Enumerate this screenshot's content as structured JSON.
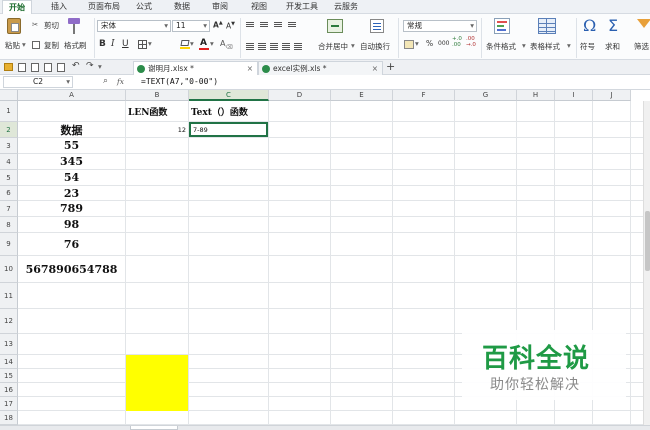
{
  "menu": {
    "items": [
      "开始",
      "插入",
      "页面布局",
      "公式",
      "数据",
      "审阅",
      "视图",
      "开发工具",
      "云服务"
    ],
    "active_index": 0
  },
  "ribbon": {
    "paste": "粘贴",
    "cut": "剪切",
    "copy": "复制",
    "format_painter": "格式刷",
    "font_name": "宋体",
    "font_size": "11",
    "merge_center": "合并居中",
    "wrap_text": "自动换行",
    "number_format": "常规",
    "conditional_format": "条件格式",
    "table_style": "表格样式",
    "symbol": "符号",
    "sum": "求和",
    "filter": "筛选",
    "percent": "%",
    "comma": "000"
  },
  "tabs": [
    {
      "label": "谢明月.xlsx *",
      "active": true
    },
    {
      "label": "excel实例.xls *",
      "active": false
    }
  ],
  "formula_bar": {
    "cell_ref": "C2",
    "fx": "fx",
    "formula": "=TEXT(A7,\"0-00\")"
  },
  "sheet": {
    "columns": [
      "A",
      "B",
      "C",
      "D",
      "E",
      "F",
      "G",
      "H",
      "I",
      "J"
    ],
    "active_column": "C",
    "rows": [
      "1",
      "2",
      "3",
      "4",
      "5",
      "6",
      "7",
      "8",
      "9",
      "10",
      "11",
      "12",
      "13",
      "14",
      "15",
      "16",
      "17",
      "18"
    ],
    "active_row": "2",
    "cells": {
      "B1": "LEN函数",
      "C1": "Text（）函数",
      "A2": "数据",
      "B2": "12",
      "C2": "7-89",
      "A3": "55",
      "A4": "345",
      "A5": "54",
      "A6": "23",
      "A7": "789",
      "A8": "98",
      "A9": "76",
      "A10": "567890654788"
    },
    "highlight_color": "#ffff00",
    "active_border_color": "#217346"
  },
  "watermark": {
    "title": "百科全说",
    "subtitle": "助你轻松解决"
  }
}
